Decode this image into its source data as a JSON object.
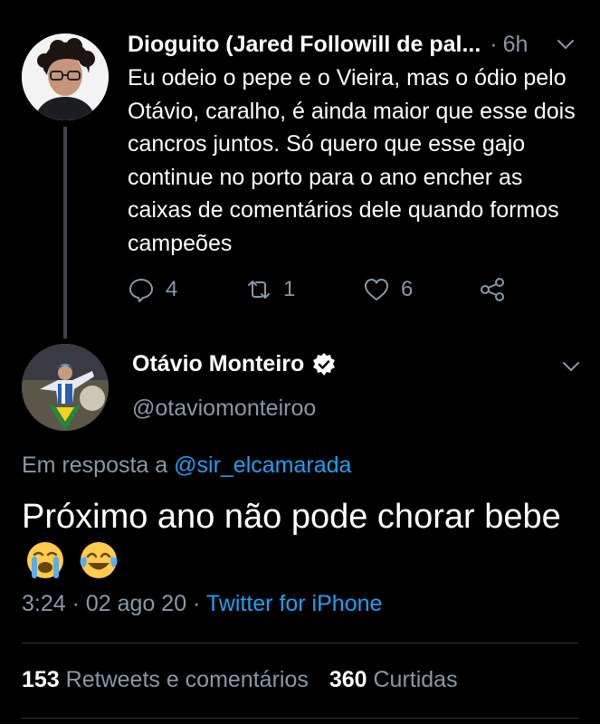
{
  "parent_tweet": {
    "display_name": "Dioguito (Jared Followill de pal...",
    "separator": "·",
    "time": "6h",
    "text": "Eu odeio o pepe e o Vieira, mas o ódio pelo Otávio, caralho, é ainda maior que esse dois cancros juntos. Só quero que esse gajo continue no porto para o ano encher as caixas de comentários dele quando formos campeões",
    "replies": "4",
    "retweets": "1",
    "likes": "6",
    "icons": [
      "reply-icon",
      "retweet-icon",
      "like-icon",
      "share-icon",
      "chevron-down-icon"
    ]
  },
  "main_tweet": {
    "display_name": "Otávio Monteiro",
    "handle": "@otaviomonteiroo",
    "reply_prefix": "Em resposta a",
    "reply_to": "@sir_elcamarada",
    "text": "Próximo ano não pode chorar bebe",
    "emojis": [
      "loudly-crying-face",
      "tears-of-joy-face"
    ],
    "time": "3:24 · 02 ago 20 ·",
    "source": "Twitter for iPhone",
    "retweets_count": "153",
    "retweets_label": "Retweets e comentários",
    "likes_count": "360",
    "likes_label": "Curtidas"
  },
  "colors": {
    "background": "#000000",
    "secondary_text": "#8899a6",
    "link": "#1da1f2"
  }
}
